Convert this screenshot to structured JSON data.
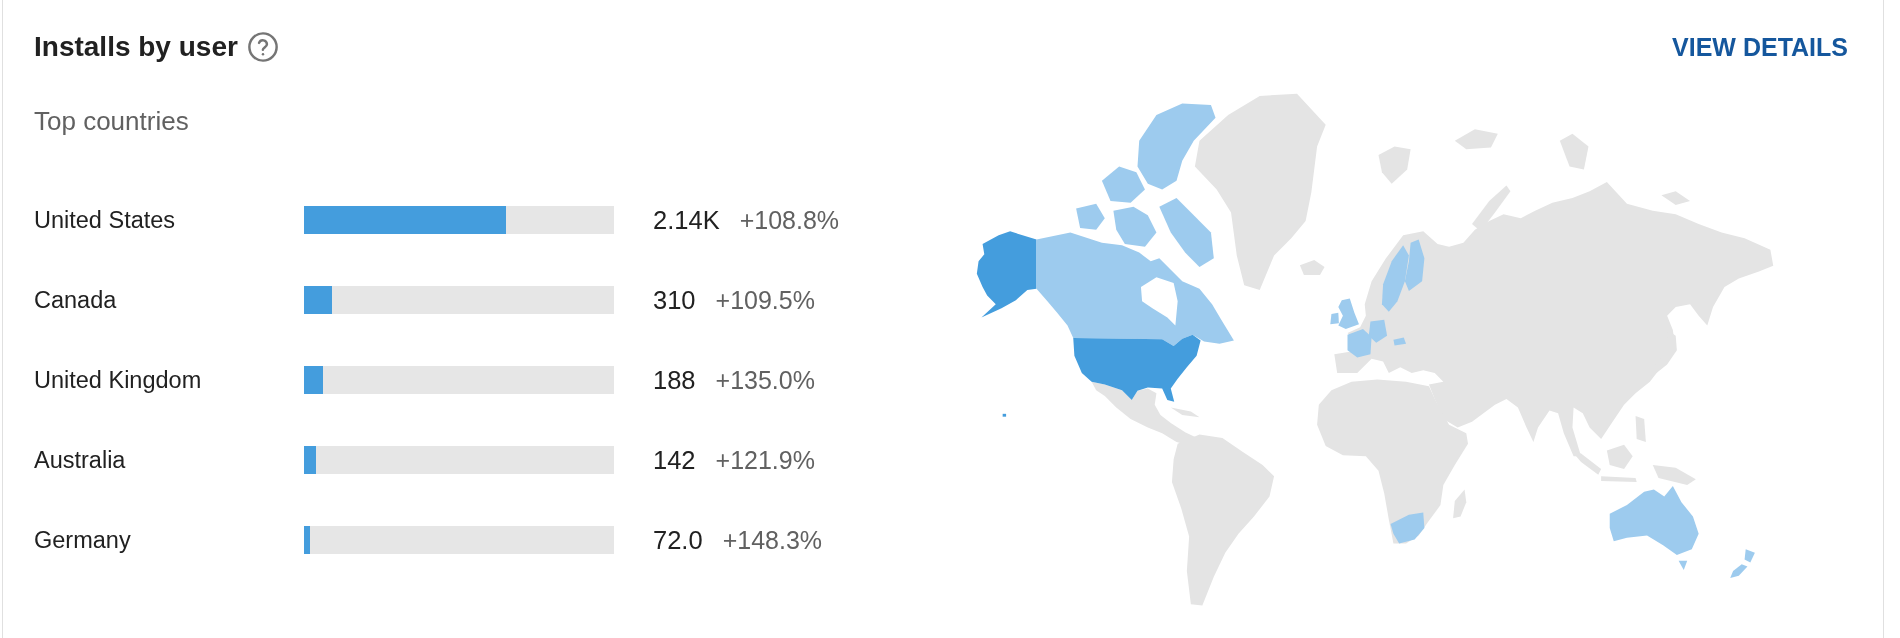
{
  "card": {
    "title": "Installs by user",
    "action": "VIEW DETAILS"
  },
  "section": {
    "subtitle": "Top countries"
  },
  "countries": [
    {
      "name": "United States",
      "level": 0.65,
      "value": "2.14K",
      "change": "+108.8%"
    },
    {
      "name": "Canada",
      "level": 0.09,
      "value": "310",
      "change": "+109.5%"
    },
    {
      "name": "United Kingdom",
      "level": 0.062,
      "value": "188",
      "change": "+135.0%"
    },
    {
      "name": "Australia",
      "level": 0.039,
      "value": "142",
      "change": "+121.9%"
    },
    {
      "name": "Germany",
      "level": 0.02,
      "value": "72.0",
      "change": "+148.3%"
    }
  ]
}
